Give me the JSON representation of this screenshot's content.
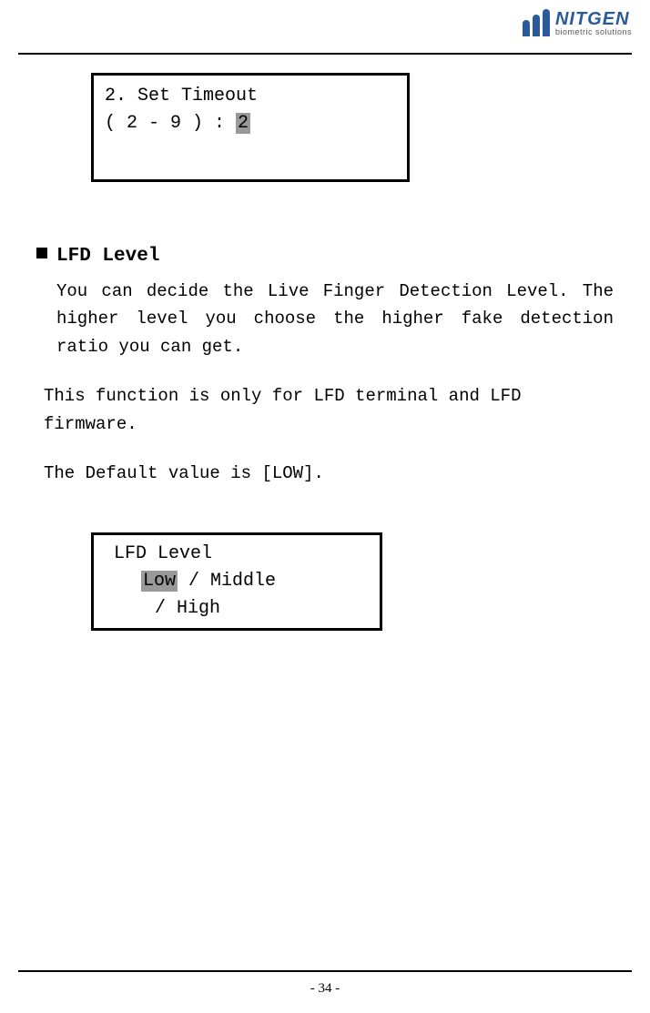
{
  "brand": {
    "name": "NITGEN",
    "tagline": "biometric solutions"
  },
  "box1": {
    "line1": "2. Set Timeout",
    "line2_prefix": "( 2 -  9 ) : ",
    "line2_highlight": "2"
  },
  "section": {
    "heading": "LFD Level",
    "para1": "You can decide the Live Finger Detection Level. The higher level you choose the higher fake detection ratio you can get.",
    "para2": "This function is only for LFD terminal and LFD firmware.",
    "para3": "The Default value is [LOW]."
  },
  "box2": {
    "line1": "LFD Level",
    "line2_highlight": "Low",
    "line2_suffix": " / Middle",
    "line3": "/ High"
  },
  "page_number": "- 34 -"
}
